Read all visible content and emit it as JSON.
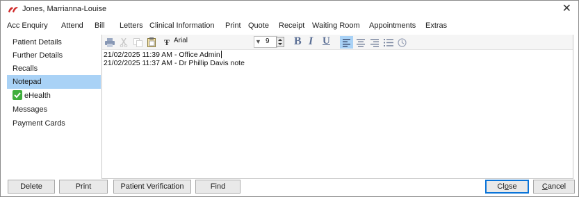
{
  "window": {
    "title": "Jones, Marrianna-Louise",
    "close_glyph": "✕"
  },
  "menu": {
    "items": [
      "Acc Enquiry",
      "Attend",
      "Bill",
      "Letters",
      "Clinical Information",
      "Print",
      "Quote",
      "Receipt",
      "Waiting Room",
      "Appointments",
      "Extras"
    ]
  },
  "sidebar": {
    "items": [
      {
        "label": "Patient Details",
        "selected": false
      },
      {
        "label": "Further Details",
        "selected": false
      },
      {
        "label": "Recalls",
        "selected": false
      },
      {
        "label": "Notepad",
        "selected": true
      },
      {
        "label": "eHealth",
        "selected": false,
        "icon": "ehealth-check-icon"
      },
      {
        "label": "Messages",
        "selected": false
      },
      {
        "label": "Payment Cards",
        "selected": false
      }
    ]
  },
  "toolbar": {
    "font_glyph": "Ŧ",
    "font_name": "Arial",
    "font_size": "9",
    "bold": "B",
    "italic": "I",
    "underline": "U",
    "icons": [
      "print-icon",
      "cut-icon",
      "copy-icon",
      "paste-icon",
      "font-icon",
      "spin-icon",
      "bold-icon",
      "italic-icon",
      "underline-icon",
      "align-left-icon",
      "align-center-icon",
      "align-right-icon",
      "bullets-icon",
      "clock-icon"
    ]
  },
  "notepad": {
    "lines": [
      "21/02/2025 11:39 AM - Office Admin",
      "21/02/2025 11:37 AM - Dr Phillip Davis note"
    ]
  },
  "buttons": {
    "delete": "Delete",
    "print": "Print",
    "patient_verification": "Patient Verification",
    "find": "Find",
    "close_pre": "Cl",
    "close_mnemonic": "o",
    "close_post": "se",
    "cancel_mnemonic": "C",
    "cancel_post": "ancel"
  },
  "colors": {
    "selection": "#a9d2f6",
    "accent_border": "#0a74d8",
    "ehealth_green": "#3fae3c",
    "format_blue": "#5b6f95"
  }
}
